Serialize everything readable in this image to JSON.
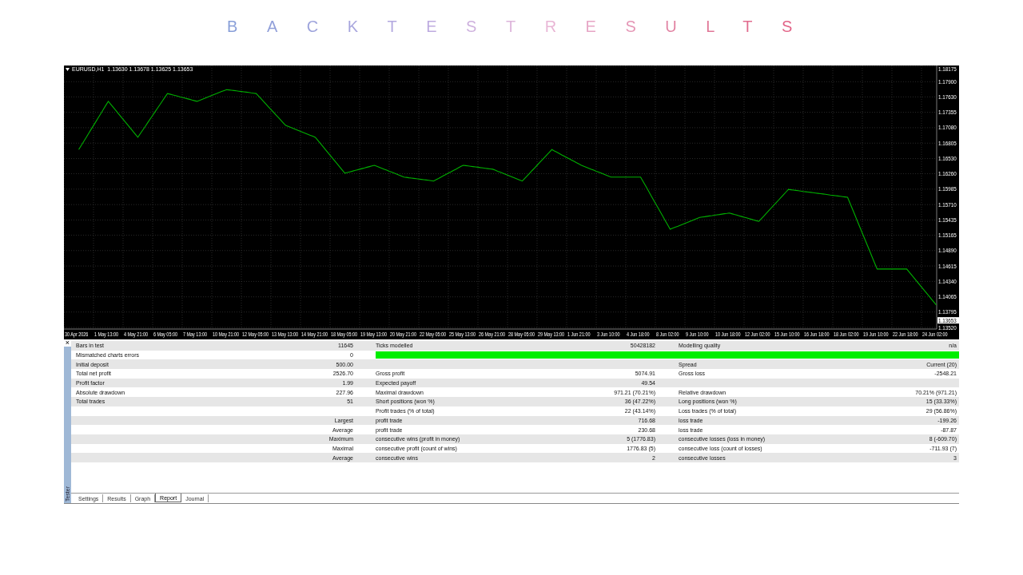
{
  "page_title": "BACKTESTRESULTS",
  "chart": {
    "symbol_info": "EURUSD,H1  1.13630 1.13678 1.13625 1.13653",
    "current_price": "1.13653",
    "chart_data": {
      "type": "line",
      "grid": true,
      "categories": [
        "30 Apr 2026",
        "1 May 13:00",
        "4 May 21:00",
        "6 May 05:00",
        "7 May 13:00",
        "10 May 21:00",
        "12 May 05:00",
        "13 May 13:00",
        "14 May 21:00",
        "18 May 05:00",
        "19 May 13:00",
        "20 May 21:00",
        "22 May 05:00",
        "25 May 13:00",
        "26 May 21:00",
        "28 May 05:00",
        "29 May 13:00",
        "1 Jun 21:00",
        "3 Jun 10:00",
        "4 Jun 18:00",
        "8 Jun 02:00",
        "9 Jun 10:00",
        "10 Jun 18:00",
        "12 Jun 02:00",
        "15 Jun 10:00",
        "16 Jun 18:00",
        "18 Jun 02:00",
        "19 Jun 10:00",
        "22 Jun 18:00",
        "24 Jun 02:00"
      ],
      "series": [
        {
          "color": "#00b000",
          "values": [
            1.1669,
            1.1755,
            1.1691,
            1.1769,
            1.1755,
            1.1776,
            1.1769,
            1.1712,
            1.1691,
            1.1627,
            1.1641,
            1.162,
            1.1613,
            1.1641,
            1.1634,
            1.1613,
            1.1669,
            1.1641,
            1.162,
            1.162,
            1.1527,
            1.1548,
            1.1556,
            1.1541,
            1.1598,
            1.1591,
            1.1584,
            1.1456,
            1.1456,
            1.1392
          ]
        }
      ],
      "ylim": [
        1.1352,
        1.18175
      ],
      "yticks": [
        {
          "value": 1.18175,
          "label": "1.18175"
        },
        {
          "value": 1.179,
          "label": "1.17900"
        },
        {
          "value": 1.1763,
          "label": "1.17630"
        },
        {
          "value": 1.17355,
          "label": "1.17355"
        },
        {
          "value": 1.1708,
          "label": "1.17080"
        },
        {
          "value": 1.16805,
          "label": "1.16805"
        },
        {
          "value": 1.1653,
          "label": "1.16530"
        },
        {
          "value": 1.1626,
          "label": "1.16260"
        },
        {
          "value": 1.15985,
          "label": "1.15985"
        },
        {
          "value": 1.1571,
          "label": "1.15710"
        },
        {
          "value": 1.15435,
          "label": "1.15435"
        },
        {
          "value": 1.15165,
          "label": "1.15165"
        },
        {
          "value": 1.1489,
          "label": "1.14890"
        },
        {
          "value": 1.14615,
          "label": "1.14615"
        },
        {
          "value": 1.1434,
          "label": "1.14340"
        },
        {
          "value": 1.14065,
          "label": "1.14065"
        },
        {
          "value": 1.13795,
          "label": "1.13795"
        },
        {
          "value": 1.1352,
          "label": "1.13520"
        }
      ]
    }
  },
  "report": {
    "close": "×",
    "side_label": "Tester",
    "rows": [
      {
        "label1": "Bars in test",
        "value1": "11645",
        "label2": "Ticks modelled",
        "value2": "50428182",
        "label3": "Modelling quality",
        "value3": "n/a"
      },
      {
        "label1": "Mismatched charts errors",
        "value1": "0",
        "quality_bar": {
          "level": 1
        }
      },
      {
        "label1": "Initial deposit",
        "value1": "500.00",
        "label3": "Spread",
        "value3": "Current (20)"
      },
      {
        "label1": "Total net profit",
        "value1": "2526.70",
        "label2": "Gross profit",
        "value2": "5074.91",
        "label3": "Gross loss",
        "value3": "-2548.21"
      },
      {
        "label1": "Profit factor",
        "value1": "1.99",
        "label2": "Expected payoff",
        "value2": "49.54"
      },
      {
        "label1": "Absolute drawdown",
        "value1": "227.96",
        "label2": "Maximal drawdown",
        "value2": "971.21 (70.21%)",
        "label3": "Relative drawdown",
        "value3": "70.21% (971.21)"
      },
      {
        "label1": "Total trades",
        "value1": "51",
        "label2": "Short positions (won %)",
        "value2": "36 (47.22%)",
        "label3": "Long positions (won %)",
        "value3": "15 (33.33%)"
      },
      {
        "label2": "Profit trades (% of total)",
        "value2": "22 (43.14%)",
        "label3": "Loss trades (% of total)",
        "value3": "29 (56.86%)"
      },
      {
        "value1": "Largest",
        "label2": "profit trade",
        "value2": "716.68",
        "label3": "loss trade",
        "value3": "-199.26"
      },
      {
        "value1": "Average",
        "label2": "profit trade",
        "value2": "230.68",
        "label3": "loss trade",
        "value3": "-87.87"
      },
      {
        "value1": "Maximum",
        "label2": "consecutive wins (profit in money)",
        "value2": "5 (1776.83)",
        "label3": "consecutive losses (loss in money)",
        "value3": "8 (-609.70)"
      },
      {
        "value1": "Maximal",
        "label2": "consecutive profit (count of wins)",
        "value2": "1776.83 (5)",
        "label3": "consecutive loss (count of losses)",
        "value3": "-711.93 (7)"
      },
      {
        "value1": "Average",
        "label2": "consecutive wins",
        "value2": "2",
        "label3": "consecutive losses",
        "value3": "3"
      }
    ],
    "tabs": [
      {
        "label": "Settings",
        "selected": false
      },
      {
        "label": "Results",
        "selected": false
      },
      {
        "label": "Graph",
        "selected": false
      },
      {
        "label": "Report",
        "selected": true
      },
      {
        "label": "Journal",
        "selected": false
      }
    ]
  }
}
